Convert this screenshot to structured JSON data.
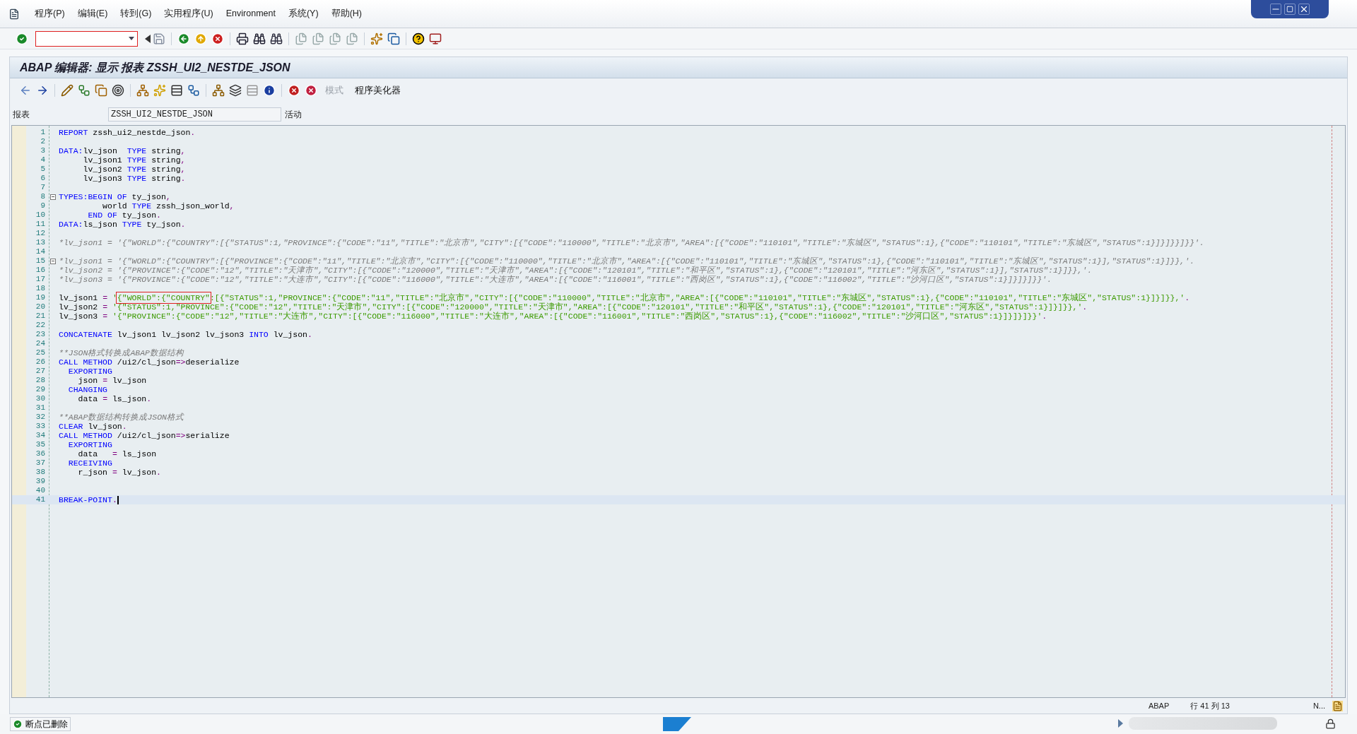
{
  "menu": [
    "程序(P)",
    "编辑(E)",
    "转到(G)",
    "实用程序(U)",
    "Environment",
    "系统(Y)",
    "帮助(H)"
  ],
  "title": "ABAP 编辑器: 显示 报表 ZSSH_UI2_NESTDE_JSON",
  "app_toolbar": [
    {
      "label": "模式",
      "disabled": true
    },
    {
      "label": "程序美化器",
      "disabled": false
    }
  ],
  "header": {
    "label": "报表",
    "value": "ZSSH_UI2_NESTDE_JSON",
    "status": "活动"
  },
  "lines": [
    {
      "n": "1",
      "fold": false,
      "current": false,
      "seg": [
        {
          "kind": "keyword",
          "t": "REPORT"
        },
        {
          "kind": "plain",
          "t": " zssh_ui2_nestde_json"
        },
        {
          "kind": "operator",
          "t": "."
        }
      ]
    },
    {
      "n": "2",
      "fold": false,
      "current": false
    },
    {
      "n": "3",
      "fold": false,
      "current": false,
      "seg": [
        {
          "kind": "keyword",
          "t": "DATA:"
        },
        {
          "kind": "plain",
          "t": "lv_json  "
        },
        {
          "kind": "keyword",
          "t": "TYPE"
        },
        {
          "kind": "plain",
          "t": " string"
        },
        {
          "kind": "operator",
          "t": ","
        }
      ]
    },
    {
      "n": "4",
      "fold": false,
      "current": false,
      "seg": [
        {
          "kind": "plain",
          "t": "     lv_json1 "
        },
        {
          "kind": "keyword",
          "t": "TYPE"
        },
        {
          "kind": "plain",
          "t": " string"
        },
        {
          "kind": "operator",
          "t": ","
        }
      ]
    },
    {
      "n": "5",
      "fold": false,
      "current": false,
      "seg": [
        {
          "kind": "plain",
          "t": "     lv_json2 "
        },
        {
          "kind": "keyword",
          "t": "TYPE"
        },
        {
          "kind": "plain",
          "t": " string"
        },
        {
          "kind": "operator",
          "t": ","
        }
      ]
    },
    {
      "n": "6",
      "fold": false,
      "current": false,
      "seg": [
        {
          "kind": "plain",
          "t": "     lv_json3 "
        },
        {
          "kind": "keyword",
          "t": "TYPE"
        },
        {
          "kind": "plain",
          "t": " string"
        },
        {
          "kind": "operator",
          "t": "."
        }
      ]
    },
    {
      "n": "7",
      "fold": false,
      "current": false
    },
    {
      "n": "8",
      "fold": true,
      "current": false,
      "seg": [
        {
          "kind": "keyword",
          "t": "TYPES:BEGIN OF"
        },
        {
          "kind": "plain",
          "t": " ty_json"
        },
        {
          "kind": "operator",
          "t": ","
        }
      ]
    },
    {
      "n": "9",
      "fold": false,
      "current": false,
      "seg": [
        {
          "kind": "plain",
          "t": "         world "
        },
        {
          "kind": "keyword",
          "t": "TYPE"
        },
        {
          "kind": "plain",
          "t": " zssh_json_world"
        },
        {
          "kind": "operator",
          "t": ","
        }
      ]
    },
    {
      "n": "10",
      "fold": false,
      "current": false,
      "seg": [
        {
          "kind": "keyword",
          "t": "      END OF"
        },
        {
          "kind": "plain",
          "t": " ty_json"
        },
        {
          "kind": "operator",
          "t": "."
        }
      ]
    },
    {
      "n": "11",
      "fold": false,
      "current": false,
      "seg": [
        {
          "kind": "keyword",
          "t": "DATA:"
        },
        {
          "kind": "plain",
          "t": "ls_json "
        },
        {
          "kind": "keyword",
          "t": "TYPE"
        },
        {
          "kind": "plain",
          "t": " ty_json"
        },
        {
          "kind": "operator",
          "t": "."
        }
      ]
    },
    {
      "n": "12",
      "fold": false,
      "current": false
    },
    {
      "n": "13",
      "fold": false,
      "current": false,
      "seg": [
        {
          "kind": "comment",
          "t": "*lv_json1 = '{\"WORLD\":{\"COUNTRY\":[{\"STATUS\":1,\"PROVINCE\":{\"CODE\":\"11\",\"TITLE\":\"北京市\",\"CITY\":[{\"CODE\":\"110000\",\"TITLE\":\"北京市\",\"AREA\":[{\"CODE\":\"110101\",\"TITLE\":\"东城区\",\"STATUS\":1},{\"CODE\":\"110101\",\"TITLE\":\"东城区\",\"STATUS\":1}]}]}}]}}'."
        }
      ]
    },
    {
      "n": "14",
      "fold": false,
      "current": false
    },
    {
      "n": "15",
      "fold": true,
      "current": false,
      "seg": [
        {
          "kind": "comment",
          "t": "*lv_json1 = '{\"WORLD\":{\"COUNTRY\":[{\"PROVINCE\":{\"CODE\":\"11\",\"TITLE\":\"北京市\",\"CITY\":[{\"CODE\":\"110000\",\"TITLE\":\"北京市\",\"AREA\":[{\"CODE\":\"110101\",\"TITLE\":\"东城区\",\"STATUS\":1},{\"CODE\":\"110101\",\"TITLE\":\"东城区\",\"STATUS\":1}],\"STATUS\":1}]}},'."
        }
      ]
    },
    {
      "n": "16",
      "fold": false,
      "current": false,
      "seg": [
        {
          "kind": "comment",
          "t": "*lv_json2 = '{\"PROVINCE\":{\"CODE\":\"12\",\"TITLE\":\"天津市\",\"CITY\":[{\"CODE\":\"120000\",\"TITLE\":\"天津市\",\"AREA\":[{\"CODE\":\"120101\",\"TITLE\":\"和平区\",\"STATUS\":1},{\"CODE\":\"120101\",\"TITLE\":\"河东区\",\"STATUS\":1}],\"STATUS\":1}]}},'."
        }
      ]
    },
    {
      "n": "17",
      "fold": false,
      "current": false,
      "seg": [
        {
          "kind": "comment",
          "t": "*lv_json3 = '{\"PROVINCE\":{\"CODE\":\"12\",\"TITLE\":\"大连市\",\"CITY\":[{\"CODE\":\"116000\",\"TITLE\":\"大连市\",\"AREA\":[{\"CODE\":\"116001\",\"TITLE\":\"西岗区\",\"STATUS\":1},{\"CODE\":\"116002\",\"TITLE\":\"沙河口区\",\"STATUS\":1}]}]}]}}'."
        }
      ]
    },
    {
      "n": "18",
      "fold": false,
      "current": false
    },
    {
      "n": "19",
      "fold": false,
      "current": false,
      "seg": [
        {
          "kind": "plain",
          "t": "lv_json1 "
        },
        {
          "kind": "operator",
          "t": "= "
        },
        {
          "kind": "string",
          "t": "'"
        },
        {
          "kind": "string",
          "t": "{\"WORLD\":{\"COUNTRY\"",
          "boxed": true
        },
        {
          "kind": "string",
          "t": ":[{\"STATUS\":1,\"PROVINCE\":{\"CODE\":\"11\",\"TITLE\":\"北京市\",\"CITY\":[{\"CODE\":\"110000\",\"TITLE\":\"北京市\",\"AREA\":[{\"CODE\":\"110101\",\"TITLE\":\"东城区\",\"STATUS\":1},{\"CODE\":\"110101\",\"TITLE\":\"东城区\",\"STATUS\":1}]}]}},'"
        },
        {
          "kind": "operator",
          "t": "."
        }
      ]
    },
    {
      "n": "20",
      "fold": false,
      "current": false,
      "seg": [
        {
          "kind": "plain",
          "t": "lv_json2 "
        },
        {
          "kind": "operator",
          "t": "= "
        },
        {
          "kind": "string",
          "t": "'{\"STATUS\":1,\"PROVINCE\":{\"CODE\":\"12\",\"TITLE\":\"天津市\",\"CITY\":[{\"CODE\":\"120000\",\"TITLE\":\"天津市\",\"AREA\":[{\"CODE\":\"120101\",\"TITLE\":\"和平区\",\"STATUS\":1},{\"CODE\":\"120101\",\"TITLE\":\"河东区\",\"STATUS\":1}]}]}},'"
        },
        {
          "kind": "operator",
          "t": "."
        }
      ]
    },
    {
      "n": "21",
      "fold": false,
      "current": false,
      "seg": [
        {
          "kind": "plain",
          "t": "lv_json3 "
        },
        {
          "kind": "operator",
          "t": "= "
        },
        {
          "kind": "string",
          "t": "'{\"PROVINCE\":{\"CODE\":\"12\",\"TITLE\":\"大连市\",\"CITY\":[{\"CODE\":\"116000\",\"TITLE\":\"大连市\",\"AREA\":[{\"CODE\":\"116001\",\"TITLE\":\"西岗区\",\"STATUS\":1},{\"CODE\":\"116002\",\"TITLE\":\"沙河口区\",\"STATUS\":1}]}]}]}}'"
        },
        {
          "kind": "operator",
          "t": "."
        }
      ]
    },
    {
      "n": "22",
      "fold": false,
      "current": false
    },
    {
      "n": "23",
      "fold": false,
      "current": false,
      "seg": [
        {
          "kind": "keyword",
          "t": "CONCATENATE"
        },
        {
          "kind": "plain",
          "t": " lv_json1 lv_json2 lv_json3 "
        },
        {
          "kind": "keyword",
          "t": "INTO"
        },
        {
          "kind": "plain",
          "t": " lv_json"
        },
        {
          "kind": "operator",
          "t": "."
        }
      ]
    },
    {
      "n": "24",
      "fold": false,
      "current": false
    },
    {
      "n": "25",
      "fold": false,
      "current": false,
      "seg": [
        {
          "kind": "comment",
          "t": "**JSON格式转换成ABAP数据结构"
        }
      ]
    },
    {
      "n": "26",
      "fold": false,
      "current": false,
      "seg": [
        {
          "kind": "keyword",
          "t": "CALL METHOD"
        },
        {
          "kind": "plain",
          "t": " /ui2/cl_json"
        },
        {
          "kind": "operator",
          "t": "=>"
        },
        {
          "kind": "plain",
          "t": "deserialize"
        }
      ]
    },
    {
      "n": "27",
      "fold": false,
      "current": false,
      "seg": [
        {
          "kind": "keyword",
          "t": "  EXPORTING"
        }
      ]
    },
    {
      "n": "28",
      "fold": false,
      "current": false,
      "seg": [
        {
          "kind": "plain",
          "t": "    json "
        },
        {
          "kind": "operator",
          "t": "="
        },
        {
          "kind": "plain",
          "t": " lv_json"
        }
      ]
    },
    {
      "n": "29",
      "fold": false,
      "current": false,
      "seg": [
        {
          "kind": "keyword",
          "t": "  CHANGING"
        }
      ]
    },
    {
      "n": "30",
      "fold": false,
      "current": false,
      "seg": [
        {
          "kind": "plain",
          "t": "    data "
        },
        {
          "kind": "operator",
          "t": "="
        },
        {
          "kind": "plain",
          "t": " ls_json"
        },
        {
          "kind": "operator",
          "t": "."
        }
      ]
    },
    {
      "n": "31",
      "fold": false,
      "current": false
    },
    {
      "n": "32",
      "fold": false,
      "current": false,
      "seg": [
        {
          "kind": "comment",
          "t": "**ABAP数据结构转换成JSON格式"
        }
      ]
    },
    {
      "n": "33",
      "fold": false,
      "current": false,
      "seg": [
        {
          "kind": "keyword",
          "t": "CLEAR"
        },
        {
          "kind": "plain",
          "t": " lv_json"
        },
        {
          "kind": "operator",
          "t": "."
        }
      ]
    },
    {
      "n": "34",
      "fold": false,
      "current": false,
      "seg": [
        {
          "kind": "keyword",
          "t": "CALL METHOD"
        },
        {
          "kind": "plain",
          "t": " /ui2/cl_json"
        },
        {
          "kind": "operator",
          "t": "=>"
        },
        {
          "kind": "plain",
          "t": "serialize"
        }
      ]
    },
    {
      "n": "35",
      "fold": false,
      "current": false,
      "seg": [
        {
          "kind": "keyword",
          "t": "  EXPORTING"
        }
      ]
    },
    {
      "n": "36",
      "fold": false,
      "current": false,
      "seg": [
        {
          "kind": "plain",
          "t": "    data   "
        },
        {
          "kind": "operator",
          "t": "="
        },
        {
          "kind": "plain",
          "t": " ls_json"
        }
      ]
    },
    {
      "n": "37",
      "fold": false,
      "current": false,
      "seg": [
        {
          "kind": "keyword",
          "t": "  RECEIVING"
        }
      ]
    },
    {
      "n": "38",
      "fold": false,
      "current": false,
      "seg": [
        {
          "kind": "plain",
          "t": "    r_json "
        },
        {
          "kind": "operator",
          "t": "="
        },
        {
          "kind": "plain",
          "t": " lv_json"
        },
        {
          "kind": "operator",
          "t": "."
        }
      ]
    },
    {
      "n": "39",
      "fold": false,
      "current": false
    },
    {
      "n": "40",
      "fold": false,
      "current": false
    },
    {
      "n": "41",
      "fold": false,
      "current": true,
      "seg": [
        {
          "kind": "keyword",
          "t": "BREAK-POINT"
        },
        {
          "kind": "operator",
          "t": "."
        }
      ]
    }
  ],
  "editor_status": {
    "language": "ABAP",
    "position": "行 41 列 13",
    "mode": "N..."
  },
  "status_bar": {
    "message": "断点已删除",
    "kind": "success"
  }
}
